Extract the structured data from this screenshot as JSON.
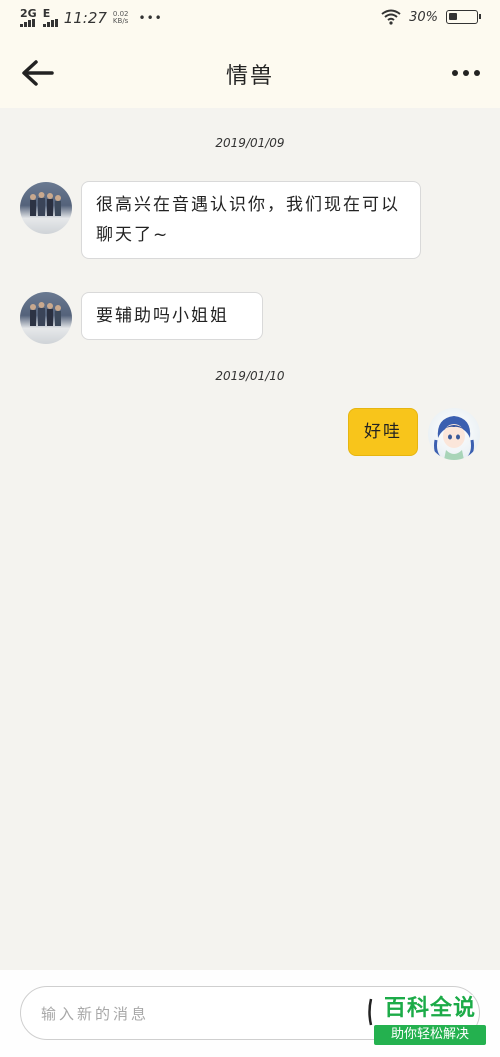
{
  "status_bar": {
    "network": "2G",
    "network2": "E",
    "time": "11:27",
    "speed_value": "0.02",
    "speed_unit": "KB/s",
    "more": "•••",
    "battery": "30%",
    "battery_level": 0.3
  },
  "header": {
    "title": "情兽"
  },
  "messages": [
    {
      "timestamp": "2019/01/09"
    },
    {
      "from": "other",
      "text": "很高兴在音遇认识你，我们现在可以聊天了~",
      "avatar": "group-photo"
    },
    {
      "from": "other",
      "text": "要辅助吗小姐姐",
      "avatar": "group-photo"
    },
    {
      "timestamp": "2019/01/10"
    },
    {
      "from": "me",
      "text": "好哇",
      "avatar": "anime-girl"
    }
  ],
  "input": {
    "placeholder": "输入新的消息",
    "value": ""
  },
  "watermark": {
    "title": "百科全说",
    "subtitle": "助你轻松解决"
  },
  "colors": {
    "header_bg": "#fdfaf0",
    "chat_bg": "#f4f3ef",
    "my_bubble": "#f8c51b",
    "other_bubble": "#ffffff",
    "watermark_green": "#1cab48"
  }
}
